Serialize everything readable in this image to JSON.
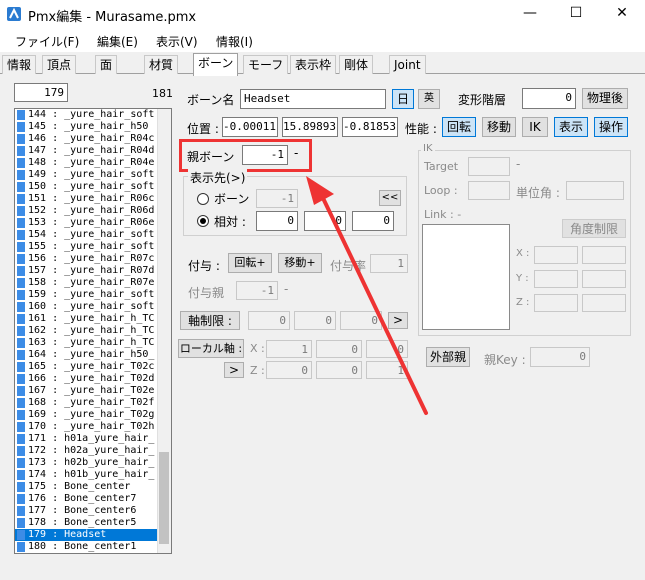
{
  "window": {
    "title": "Pmx編集 - Murasame.pmx",
    "minimize": "—",
    "maximize": "☐",
    "close": "✕"
  },
  "menu": [
    "ファイル(F)",
    "編集(E)",
    "表示(V)",
    "情報(I)"
  ],
  "tabs": [
    "情報",
    "頂点",
    "面",
    "材質",
    "ボーン",
    "モーフ",
    "表示枠",
    "剛体",
    "Joint"
  ],
  "active_tab": "ボーン",
  "list": {
    "index_value": "179",
    "count": "181",
    "rows": [
      "144 : _yure_hair_soft",
      "145 : _yure_hair_h50",
      "146 : _yure_hair_R04c",
      "147 : _yure_hair_R04d",
      "148 : _yure_hair_R04e",
      "149 : _yure_hair_soft",
      "150 : _yure_hair_soft",
      "151 : _yure_hair_R06c",
      "152 : _yure_hair_R06d",
      "153 : _yure_hair_R06e",
      "154 : _yure_hair_soft",
      "155 : _yure_hair_soft",
      "156 : _yure_hair_R07c",
      "157 : _yure_hair_R07d",
      "158 : _yure_hair_R07e",
      "159 : _yure_hair_soft",
      "160 : _yure_hair_soft",
      "161 : _yure_hair_h_TC",
      "162 : _yure_hair_h_TC",
      "163 : _yure_hair_h_TC",
      "164 : _yure_hair_h50_",
      "165 : _yure_hair_T02c",
      "166 : _yure_hair_T02d",
      "167 : _yure_hair_T02e",
      "168 : _yure_hair_T02f",
      "169 : _yure_hair_T02g",
      "170 : _yure_hair_T02h",
      "171 : h01a_yure_hair_",
      "172 : h02a_yure_hair_",
      "173 : h02b_yure_hair_",
      "174 : h01b_yure_hair_",
      "175 : Bone_center",
      "176 : Bone_center7",
      "177 : Bone_center6",
      "178 : Bone_center5",
      "179 : Headset",
      "180 : Bone_center1"
    ],
    "selected_row": "179 : Headset"
  },
  "bone": {
    "name_label": "ボーン名",
    "name_value": "Headset",
    "jp_button": "日",
    "en_button": "英",
    "deform_label": "変形階層",
    "deform_value": "0",
    "physics_button": "物理後",
    "position_label": "位置 :",
    "pos_x": "-0.00011",
    "pos_y": "15.89893",
    "pos_z": "-0.81853",
    "performance_label": "性能 :",
    "flags": [
      "回転",
      "移動",
      "IK",
      "表示",
      "操作"
    ],
    "parent_label": "親ボーン",
    "parent_value": "-1",
    "parent_suffix": "-",
    "display_label": "表示先(>)",
    "radio_bone": "ボーン",
    "radio_bone_value": "-1",
    "link_button": "<<",
    "radio_relative": "相対 :",
    "rel_x": "0",
    "rel_y": "0",
    "rel_z": "0",
    "grant_label": "付与 :",
    "grant_rot": "回転+",
    "grant_move": "移動+",
    "grant_rate_label": "付与率",
    "grant_rate_value": "1",
    "grant_parent_label": "付与親",
    "grant_parent_value": "-1",
    "grant_parent_suffix": "-",
    "axis_limit_button": "軸制限 :",
    "axis_x": "0",
    "axis_y": "0",
    "axis_z": "0",
    "axis_arrow": ">",
    "local_axis_button": "ローカル軸 :",
    "local_x_label": "X :",
    "local_x": [
      "1",
      "0",
      "0"
    ],
    "local_z_label": "Z :",
    "local_z": [
      "0",
      "0",
      "1"
    ],
    "local_arrow": ">",
    "external_parent_button": "外部親",
    "parent_key_label": "親Key :",
    "parent_key_value": "0"
  },
  "ik": {
    "group_label": "IK",
    "target_label": "Target",
    "target_suffix": "-",
    "loop_label": "Loop :",
    "unit_angle_label": "単位角 :",
    "link_label": "Link : -",
    "angle_limit_button": "角度制限",
    "x_label": "X :",
    "y_label": "Y :",
    "z_label": "Z :"
  }
}
